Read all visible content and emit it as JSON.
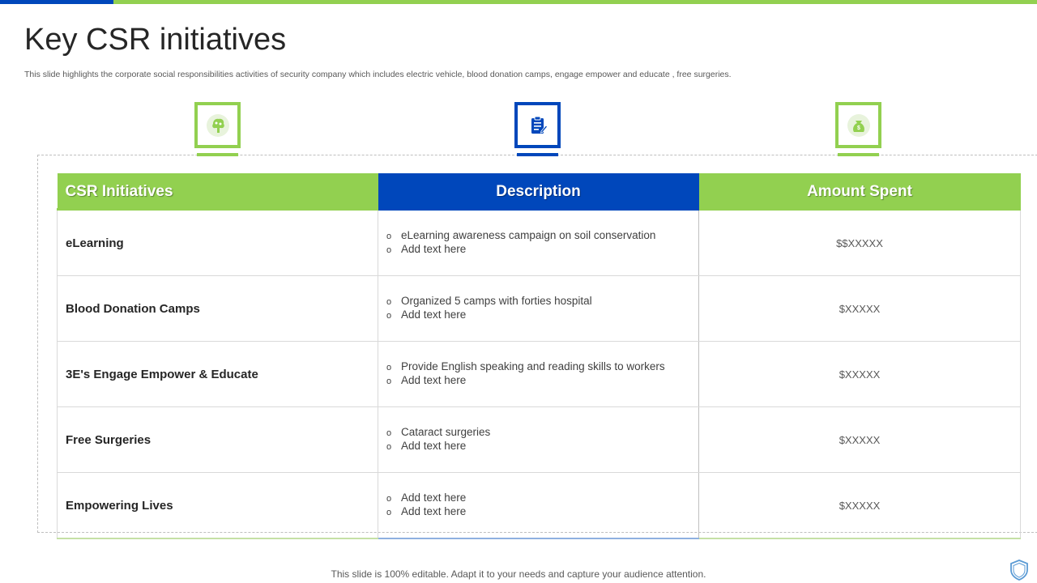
{
  "slide": {
    "title": "Key CSR initiatives",
    "subtitle": "This slide highlights the corporate social responsibilities activities of security company which includes electric vehicle, blood donation camps, engage empower and educate , free surgeries.",
    "footer": "This slide is 100% editable. Adapt it to your  needs and capture your audience attention."
  },
  "icons": [
    {
      "name": "tree-brain-icon",
      "color": "#92d050"
    },
    {
      "name": "clipboard-checklist-icon",
      "color": "#0047bb"
    },
    {
      "name": "money-bag-icon",
      "color": "#92d050"
    }
  ],
  "table": {
    "headers": [
      "CSR Initiatives",
      "Description",
      "Amount Spent"
    ],
    "rows": [
      {
        "name": "eLearning",
        "bullets": [
          "eLearning  awareness  campaign  on  soil conservation",
          "Add text here"
        ],
        "amount": "$$XXXXX"
      },
      {
        "name": "Blood Donation Camps",
        "bullets": [
          "Organized  5 camps with forties  hospital",
          "Add text here"
        ],
        "amount": "$XXXXX"
      },
      {
        "name": "3E's Engage Empower & Educate",
        "bullets": [
          "Provide  English speaking and reading  skills to workers",
          "Add text here"
        ],
        "amount": "$XXXXX"
      },
      {
        "name": "Free Surgeries",
        "bullets": [
          "Cataract  surgeries",
          "Add text here"
        ],
        "amount": "$XXXXX"
      },
      {
        "name": "Empowering Lives",
        "bullets": [
          "Add text here",
          "Add text here"
        ],
        "amount": "$XXXXX"
      }
    ],
    "bullet_mark": "o"
  },
  "colors": {
    "green": "#92d050",
    "blue": "#0047bb"
  }
}
